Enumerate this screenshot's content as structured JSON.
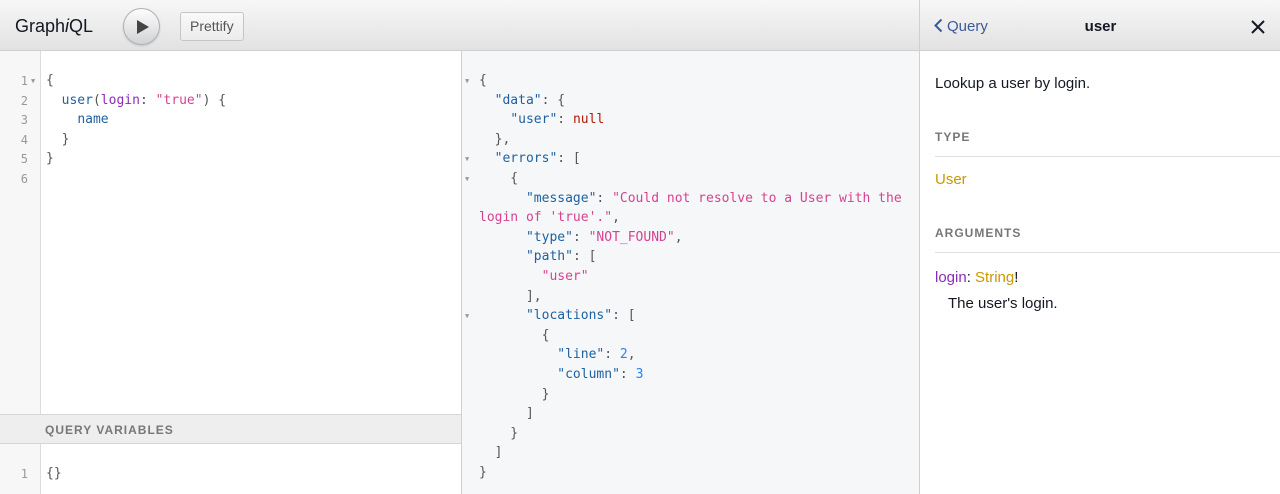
{
  "toolbar": {
    "logo_pre": "Graph",
    "logo_i": "i",
    "logo_post": "QL",
    "prettify_label": "Prettify",
    "run_icon": "play-icon"
  },
  "query_editor": {
    "line_numbers": [
      "1",
      "2",
      "3",
      "4",
      "5",
      "6"
    ],
    "lines": [
      [
        {
          "t": "{",
          "c": "p"
        }
      ],
      [
        {
          "t": "  ",
          "c": ""
        },
        {
          "t": "user",
          "c": "f"
        },
        {
          "t": "(",
          "c": "p"
        },
        {
          "t": "login",
          "c": "a"
        },
        {
          "t": ": ",
          "c": "p"
        },
        {
          "t": "\"true\"",
          "c": "s"
        },
        {
          "t": ") {",
          "c": "p"
        }
      ],
      [
        {
          "t": "    ",
          "c": ""
        },
        {
          "t": "name",
          "c": "f"
        }
      ],
      [
        {
          "t": "  }",
          "c": "p"
        }
      ],
      [
        {
          "t": "}",
          "c": "p"
        }
      ],
      []
    ]
  },
  "variables": {
    "title": "QUERY VARIABLES",
    "line_numbers": [
      "1"
    ],
    "lines": [
      [
        {
          "t": "{}",
          "c": "p"
        }
      ]
    ]
  },
  "result": {
    "lines": [
      [
        {
          "t": "{",
          "c": "p"
        }
      ],
      [
        {
          "t": "  ",
          "c": ""
        },
        {
          "t": "\"data\"",
          "c": "k"
        },
        {
          "t": ": {",
          "c": "p"
        }
      ],
      [
        {
          "t": "    ",
          "c": ""
        },
        {
          "t": "\"user\"",
          "c": "k"
        },
        {
          "t": ": ",
          "c": "p"
        },
        {
          "t": "null",
          "c": "kw"
        }
      ],
      [
        {
          "t": "  },",
          "c": "p"
        }
      ],
      [
        {
          "t": "  ",
          "c": ""
        },
        {
          "t": "\"errors\"",
          "c": "k"
        },
        {
          "t": ": [",
          "c": "p"
        }
      ],
      [
        {
          "t": "    {",
          "c": "p"
        }
      ],
      [
        {
          "t": "      ",
          "c": ""
        },
        {
          "t": "\"message\"",
          "c": "k"
        },
        {
          "t": ": ",
          "c": "p"
        },
        {
          "t": "\"Could not resolve to a User with the",
          "c": "s"
        }
      ],
      [
        {
          "t": "login of 'true'.\"",
          "c": "s"
        },
        {
          "t": ",",
          "c": "p"
        }
      ],
      [
        {
          "t": "      ",
          "c": ""
        },
        {
          "t": "\"type\"",
          "c": "k"
        },
        {
          "t": ": ",
          "c": "p"
        },
        {
          "t": "\"NOT_FOUND\"",
          "c": "s"
        },
        {
          "t": ",",
          "c": "p"
        }
      ],
      [
        {
          "t": "      ",
          "c": ""
        },
        {
          "t": "\"path\"",
          "c": "k"
        },
        {
          "t": ": [",
          "c": "p"
        }
      ],
      [
        {
          "t": "        ",
          "c": ""
        },
        {
          "t": "\"user\"",
          "c": "s"
        }
      ],
      [
        {
          "t": "      ],",
          "c": "p"
        }
      ],
      [
        {
          "t": "      ",
          "c": ""
        },
        {
          "t": "\"locations\"",
          "c": "k"
        },
        {
          "t": ": [",
          "c": "p"
        }
      ],
      [
        {
          "t": "        {",
          "c": "p"
        }
      ],
      [
        {
          "t": "          ",
          "c": ""
        },
        {
          "t": "\"line\"",
          "c": "k"
        },
        {
          "t": ": ",
          "c": "p"
        },
        {
          "t": "2",
          "c": "n"
        },
        {
          "t": ",",
          "c": "p"
        }
      ],
      [
        {
          "t": "          ",
          "c": ""
        },
        {
          "t": "\"column\"",
          "c": "k"
        },
        {
          "t": ": ",
          "c": "p"
        },
        {
          "t": "3",
          "c": "n"
        }
      ],
      [
        {
          "t": "        }",
          "c": "p"
        }
      ],
      [
        {
          "t": "      ]",
          "c": "p"
        }
      ],
      [
        {
          "t": "    }",
          "c": "p"
        }
      ],
      [
        {
          "t": "  ]",
          "c": "p"
        }
      ],
      [
        {
          "t": "}",
          "c": "p"
        }
      ]
    ]
  },
  "doc_explorer": {
    "back_label": "Query",
    "title": "user",
    "description": "Lookup a user by login.",
    "type_heading": "TYPE",
    "type_name": "User",
    "arguments_heading": "ARGUMENTS",
    "arg_name": "login",
    "arg_sep": ": ",
    "arg_type": "String",
    "arg_bang": "!",
    "arg_description": "The user's login."
  }
}
